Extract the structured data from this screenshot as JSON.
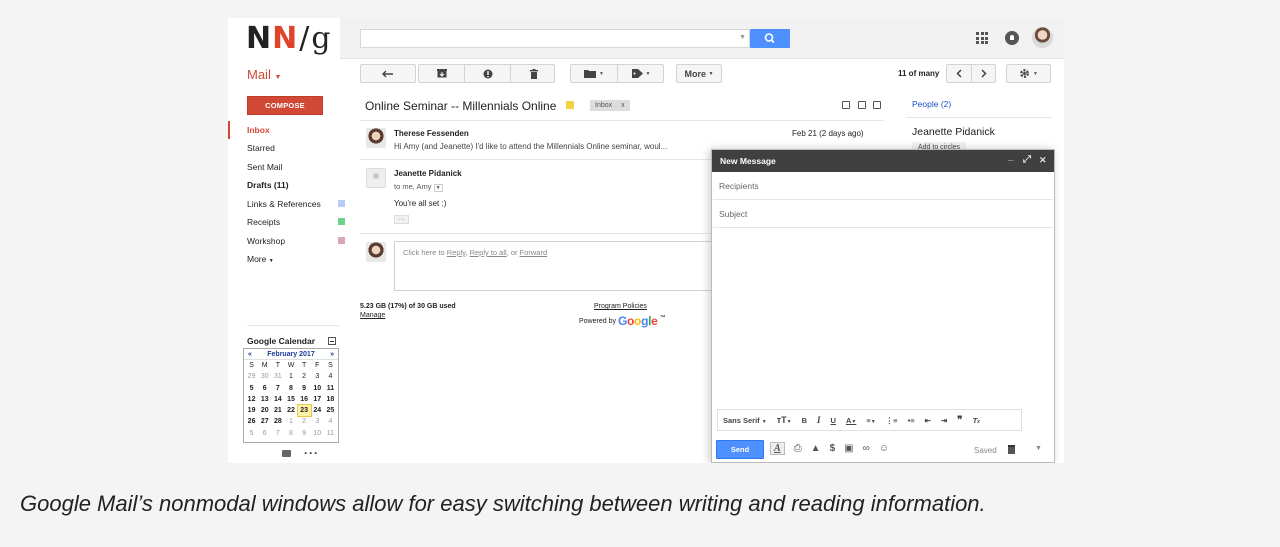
{
  "logo": {
    "n1": "N",
    "n2": "N",
    "slash": "/",
    "g": "g"
  },
  "header": {
    "apps_icon": "apps-grid-icon",
    "notif_icon": "notification-icon"
  },
  "toolbar": {
    "more_label": "More",
    "count_text": "11 of many",
    "icons": [
      "back-arrow-icon",
      "archive-icon",
      "report-spam-icon",
      "delete-icon",
      "move-to-icon",
      "labels-icon",
      "prev-icon",
      "next-icon",
      "settings-gear-icon"
    ]
  },
  "sidebar": {
    "mail_label": "Mail",
    "compose_label": "COMPOSE",
    "items": [
      {
        "label": "Inbox",
        "color": "#d14836"
      },
      {
        "label": "Starred"
      },
      {
        "label": "Sent Mail"
      },
      {
        "label": "Drafts (11)"
      },
      {
        "label": "Links & References",
        "swatch": "#b8ccf5"
      },
      {
        "label": "Receipts",
        "swatch": "#6fd08a"
      },
      {
        "label": "Workshop",
        "swatch": "#d8a8b8"
      },
      {
        "label": "More"
      }
    ]
  },
  "thread": {
    "subject": "Online Seminar -- Millennials Online",
    "label_chip": "Inbox",
    "label_chip_x": "x",
    "messages": [
      {
        "sender": "Therese Fessenden",
        "date": "Feb 21 (2 days ago)",
        "snippet": "Hi Amy (and Jeanette) I'd like to attend the Millennials Online seminar, woul..."
      },
      {
        "sender": "Jeanette Pidanick",
        "to": "to me, Amy",
        "body": "You're all set :)",
        "ellipsis": "···"
      }
    ],
    "reply_prefix": "Click here to ",
    "reply_link": "Reply",
    "reply_sep1": ", ",
    "reply_all": "Reply to all",
    "reply_sep2": ", or ",
    "forward": "Forward"
  },
  "footer": {
    "storage": "5.23 GB (17%) of 30 GB used",
    "manage": "Manage",
    "policies": "Program Policies",
    "powered_by": "Powered by",
    "google": [
      "G",
      "o",
      "o",
      "g",
      "l",
      "e"
    ],
    "tm": "™",
    "google_colors": [
      "#4285f4",
      "#ea4335",
      "#fbbc05",
      "#4285f4",
      "#34a853",
      "#ea4335"
    ]
  },
  "people": {
    "title": "People (2)",
    "name": "Jeanette Pidanick",
    "add_label": "Add to circles"
  },
  "calendar": {
    "title": "Google Calendar",
    "month": "February 2017",
    "prev": "«",
    "next": "»",
    "weekdays": [
      "S",
      "M",
      "T",
      "W",
      "T",
      "F",
      "S"
    ],
    "days": [
      [
        "29",
        "30",
        "31",
        "1",
        "2",
        "3",
        "4"
      ],
      [
        "5",
        "6",
        "7",
        "8",
        "9",
        "10",
        "11"
      ],
      [
        "12",
        "13",
        "14",
        "15",
        "16",
        "17",
        "18"
      ],
      [
        "19",
        "20",
        "21",
        "22",
        "23",
        "24",
        "25"
      ],
      [
        "26",
        "27",
        "28",
        "1",
        "2",
        "3",
        "4"
      ],
      [
        "5",
        "6",
        "7",
        "8",
        "9",
        "10",
        "11"
      ]
    ],
    "today": "23"
  },
  "compose_window": {
    "title": "New Message",
    "minimize": "_",
    "expand": "⤢",
    "close": "✕",
    "recipients_placeholder": "Recipients",
    "subject_placeholder": "Subject",
    "font_label": "Sans Serif",
    "send_label": "Send",
    "saved_label": "Saved"
  },
  "caption": "Google Mail’s nonmodal windows allow for easy switching between writing and reading information."
}
